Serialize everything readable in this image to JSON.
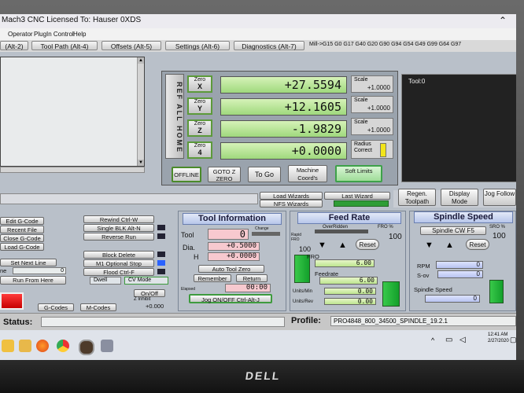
{
  "window_title": "Mach3 CNC  Licensed To: Hauser 0XDS",
  "menu": [
    "Operator",
    "PlugIn Control",
    "Help"
  ],
  "tabs": [
    "(Alt-2)",
    "Tool Path (Alt-4)",
    "Offsets (Alt-5)",
    "Settings (Alt-6)",
    "Diagnostics (Alt-7)"
  ],
  "gcode_line": "Mill->G15  G0 G17 G40 G20 G90 G94 G54 G49 G99 G64 G97",
  "ref_all_home": "REF ALL HOME",
  "axes": [
    {
      "zero_label": "Zero",
      "axis": "X",
      "value": "+27.5594",
      "scale_label": "Scale",
      "scale": "+1.0000"
    },
    {
      "zero_label": "Zero",
      "axis": "Y",
      "value": "+12.1605",
      "scale_label": "Scale",
      "scale": "+1.0000"
    },
    {
      "zero_label": "Zero",
      "axis": "Z",
      "value": "-1.9829",
      "scale_label": "Scale",
      "scale": "+1.0000"
    },
    {
      "zero_label": "Zero",
      "axis": "4",
      "value": "+0.0000",
      "scale_label": "Radius Correct",
      "scale": ""
    }
  ],
  "dro_buttons": {
    "offline": "OFFLINE",
    "gotz": "GOTO Z ZERO",
    "goto": "To Go",
    "machine_coords": "Machine Coord's",
    "soft_limits": "Soft Limits"
  },
  "tool_display": "Tool:0",
  "right_buttons": {
    "regen": "Regen. Toolpath",
    "display_mode": "Display Mode",
    "jog_follow": "Jog Follow"
  },
  "wizards": {
    "load": "Load Wizards",
    "last": "Last Wizard",
    "nfs": "NFS Wizards"
  },
  "program": {
    "edit": "Edit G-Code",
    "recent": "Recent File",
    "close": "Close G-Code",
    "load": "Load G-Code",
    "next_line": "Set Next Line",
    "line_label": "ne",
    "line_value": "0",
    "run_from_here": "Run From Here",
    "rewind": "Rewind Ctrl-W",
    "single_blk": "Single BLK Alt-N",
    "reverse_run": "Reverse Run",
    "block_delete": "Block Delete",
    "m1_stop": "M1 Optional Stop",
    "flood": "Flood Ctrl-F",
    "dwell": "Dwell",
    "cv_mode": "CV Mode",
    "on_off": "On/Off",
    "z_inhibit": "Z Inhibit",
    "z_inhibit_value": "+0.000",
    "gcodes": "G-Codes",
    "mcodes": "M-Codes"
  },
  "tool_info": {
    "title": "Tool Information",
    "tool_label": "Tool",
    "tool_value": "0",
    "change_label": "Change",
    "dia_label": "Dia.",
    "dia_value": "+0.5000",
    "h_label": "H",
    "h_value": "+0.0000",
    "auto_zero": "Auto Tool Zero",
    "remember": "Remember",
    "return": "Return",
    "elapsed_label": "Elapsed",
    "elapsed_value": "00:00",
    "jog": "Jog ON/OFF Ctrl-Alt-J"
  },
  "feed": {
    "title": "Feed Rate",
    "overridden": "OverRidden",
    "fro_pct_label": "FRO %",
    "fro_pct": "100",
    "rapid_label": "Rapid FRO",
    "rapid_value": "100",
    "reset": "Reset",
    "fro_label": "FRO",
    "fro_value": "6.00",
    "feedrate_label": "Feedrate",
    "feedrate_value": "6.00",
    "units_min": "Units/Min",
    "units_min_value": "0.00",
    "units_rev": "Units/Rev",
    "units_rev_value": "0.00"
  },
  "spindle": {
    "title": "Spindle Speed",
    "cw": "Spindle CW F5",
    "sro_label": "SRO %",
    "sro_value": "100",
    "reset": "Reset",
    "rpm_label": "RPM",
    "rpm_value": "0",
    "sov_label": "S-ov",
    "sov_value": "0",
    "speed_label": "Spindle Speed",
    "speed_value": "0"
  },
  "status_label": "Status:",
  "profile_label": "Profile:",
  "profile_value": "PRO4848_800_34500_SPINDLE_19.2.1",
  "clock_time": "12:41 AM",
  "clock_date": "2/27/2020",
  "brand": "DELL",
  "colors": {
    "dro_green": "#9fd97d",
    "header_blue": "#b7c6ea",
    "bar_green": "#13a02b",
    "reset_red": "#e01818"
  }
}
